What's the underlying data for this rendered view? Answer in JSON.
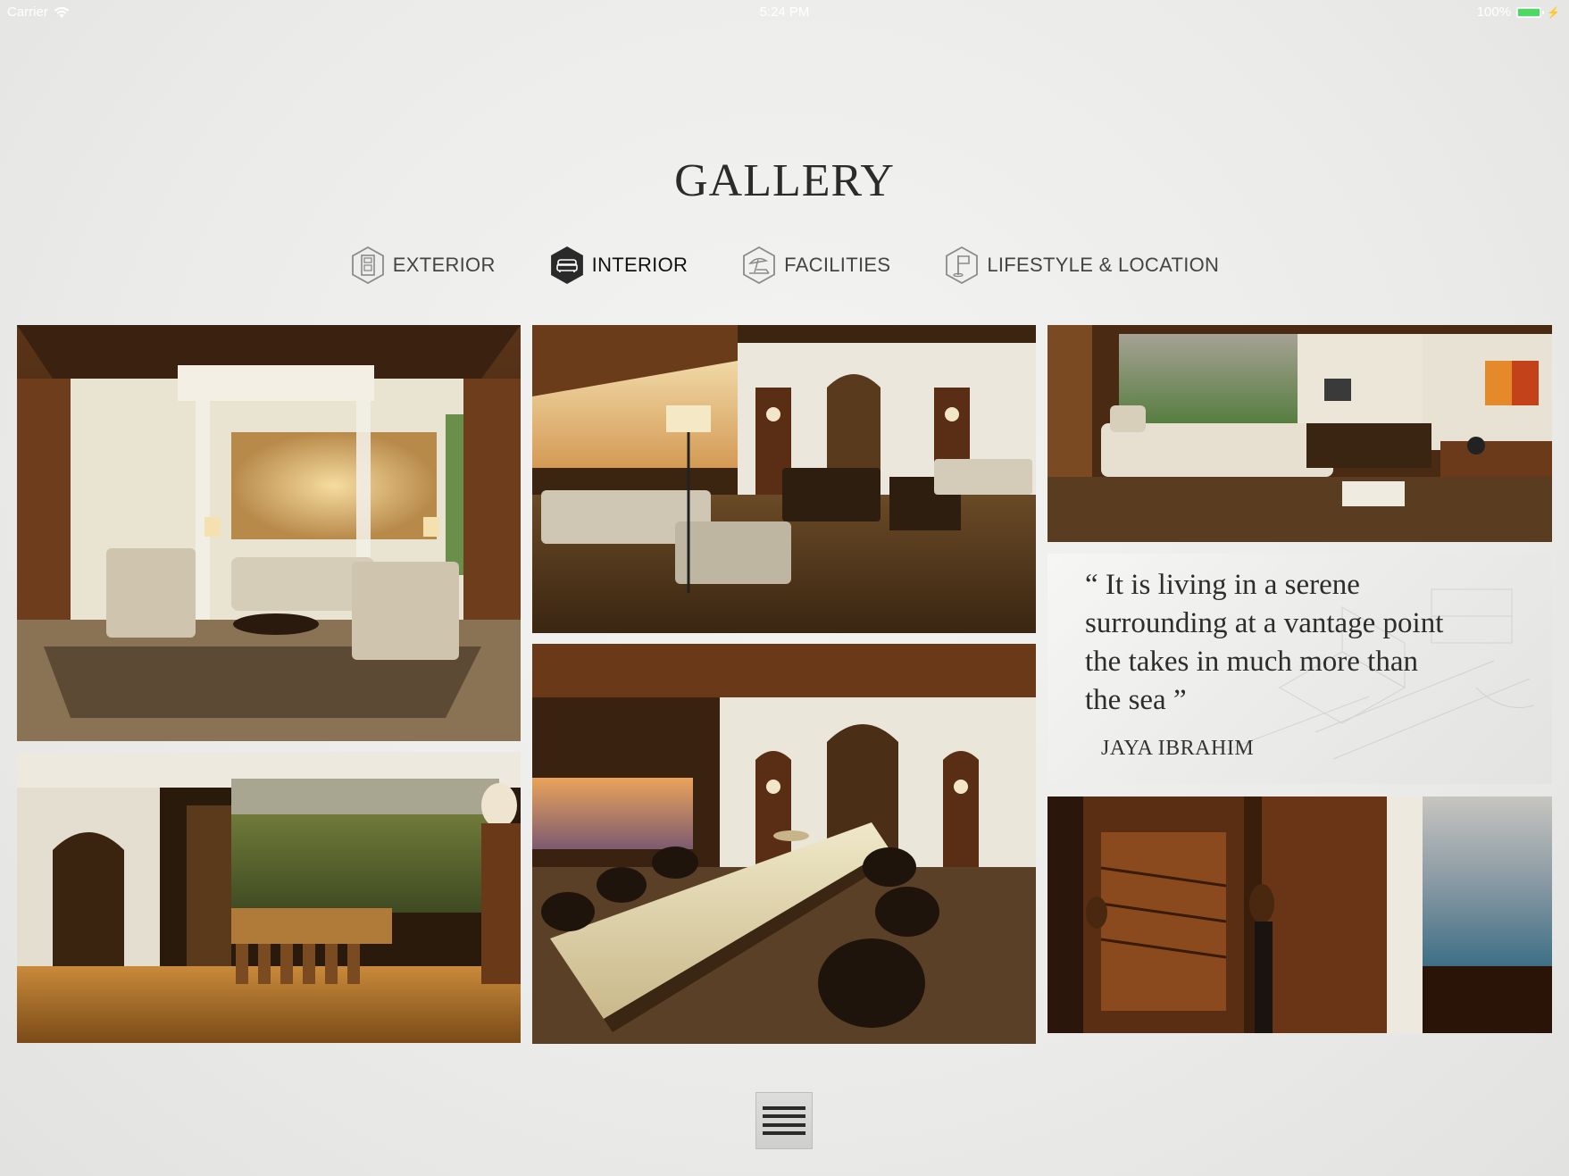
{
  "status_bar": {
    "carrier": "Carrier",
    "time": "5:24 PM",
    "battery": "100%",
    "battery_level": 1.0
  },
  "page": {
    "title": "GALLERY"
  },
  "tabs": [
    {
      "label": "EXTERIOR",
      "icon": "building-icon",
      "active": false
    },
    {
      "label": "INTERIOR",
      "icon": "sofa-icon",
      "active": true
    },
    {
      "label": "FACILITIES",
      "icon": "beach-umbrella-icon",
      "active": false
    },
    {
      "label": "LIFESTYLE & LOCATION",
      "icon": "golf-flag-icon",
      "active": false
    }
  ],
  "quote": {
    "text": "“ It is living in a serene\n   surrounding at a vantage point\n   the takes in much more than\n   the sea ”",
    "author": "JAYA IBRAHIM"
  },
  "photos": [
    {
      "name": "canopy-bedroom-photo"
    },
    {
      "name": "living-room-photo"
    },
    {
      "name": "bedroom-suite-photo"
    },
    {
      "name": "bar-lounge-photo"
    },
    {
      "name": "dining-room-photo"
    },
    {
      "name": "spiral-staircase-photo"
    }
  ],
  "colors": {
    "active_tab_icon": "#2a2a2a",
    "inactive_tab_icon": "#8a8a8a",
    "battery_green": "#4cd964"
  }
}
